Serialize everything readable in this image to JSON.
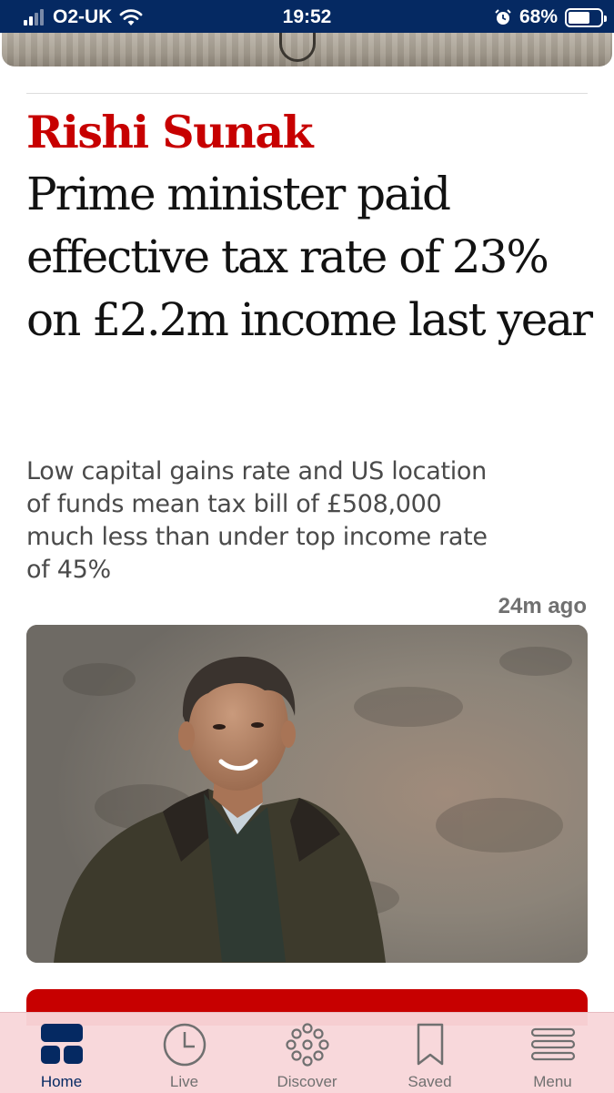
{
  "status_bar": {
    "carrier": "O2-UK",
    "time": "19:52",
    "battery_percent": "68%",
    "battery_level": 0.68,
    "signal_bars": 4,
    "signal_bars_active": 2
  },
  "article": {
    "kicker": "Rishi Sunak",
    "headline": "Prime minister paid effective tax rate of 23% on £2.2m income last year",
    "standfirst": "Low capital gains rate and US location of funds mean tax bill of £508,000 much less than under top income rate of 45%",
    "timestamp": "24m ago"
  },
  "colors": {
    "brand_navy": "#052962",
    "kicker_red": "#c70000",
    "tab_bar_bg": "#f8d6da"
  },
  "tab_bar": {
    "tabs": [
      {
        "label": "Home",
        "icon": "home-grid-icon",
        "active": true
      },
      {
        "label": "Live",
        "icon": "clock-icon",
        "active": false
      },
      {
        "label": "Discover",
        "icon": "discover-dots-icon",
        "active": false
      },
      {
        "label": "Saved",
        "icon": "bookmark-icon",
        "active": false
      },
      {
        "label": "Menu",
        "icon": "hamburger-menu-icon",
        "active": false
      }
    ]
  }
}
